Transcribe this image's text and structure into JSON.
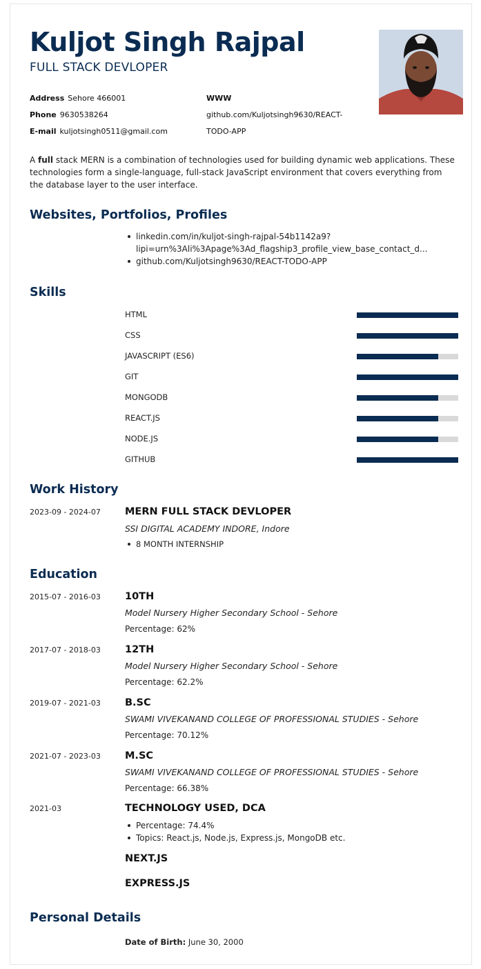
{
  "header": {
    "name": "Kuljot Singh Rajpal",
    "title": "FULL STACK DEVLOPER",
    "photo_alt": "profile-photo"
  },
  "contact": {
    "address_label": "Address",
    "address": "Sehore 466001",
    "phone_label": "Phone",
    "phone": "9630538264",
    "email_label": "E-mail",
    "email": "kuljotsingh0511@gmail.com",
    "www_label": "WWW",
    "www_line1": "github.com/Kuljotsingh9630/REACT-",
    "www_line2": "TODO-APP"
  },
  "summary": {
    "prefix": "A ",
    "bold": "full",
    "rest": " stack MERN is a combination of technologies used for building dynamic web applications. These technologies form a single-language, full-stack JavaScript environment that covers everything from the database layer to the user interface."
  },
  "sections": {
    "websites": "Websites, Portfolios, Profiles",
    "skills": "Skills",
    "work": "Work History",
    "education": "Education",
    "personal": "Personal Details"
  },
  "websites": [
    "linkedin.com/in/kuljot-singh-rajpal-54b1142a9?",
    "lipi=urn%3Ali%3Apage%3Ad_flagship3_profile_view_base_contact_d...",
    "github.com/Kuljotsingh9630/REACT-TODO-APP"
  ],
  "skills": [
    {
      "name": "HTML",
      "level": 1.0
    },
    {
      "name": "CSS",
      "level": 1.0
    },
    {
      "name": "JAVASCRIPT (ES6)",
      "level": 0.8
    },
    {
      "name": "GIT",
      "level": 1.0
    },
    {
      "name": "MONGODB",
      "level": 0.8
    },
    {
      "name": "REACT.JS",
      "level": 0.8
    },
    {
      "name": "NODE.JS",
      "level": 0.8
    },
    {
      "name": "GITHUB",
      "level": 1.0
    }
  ],
  "work": {
    "date": "2023-09 - 2024-07",
    "title": "MERN FULL STACK DEVLOPER",
    "company": "SSI DIGITAL ACADEMY INDORE, Indore",
    "bullet": "8 MONTH INTERNSHIP"
  },
  "education": [
    {
      "date": "2015-07 - 2016-03",
      "title": "10TH",
      "school": "Model Nursery Higher Secondary School - Sehore",
      "detail": "Percentage: 62%"
    },
    {
      "date": "2017-07 - 2018-03",
      "title": "12TH",
      "school": "Model Nursery Higher Secondary School - Sehore",
      "detail": "Percentage: 62.2%"
    },
    {
      "date": "2019-07 - 2021-03",
      "title": "B.SC",
      "school": "SWAMI VIVEKANAND COLLEGE OF PROFESSIONAL STUDIES - Sehore",
      "detail": "Percentage: 70.12%"
    },
    {
      "date": "2021-07 - 2023-03",
      "title": "M.SC",
      "school": "SWAMI VIVEKANAND COLLEGE OF PROFESSIONAL STUDIES - Sehore",
      "detail": "Percentage: 66.38%"
    }
  ],
  "dca": {
    "date": "2021-03",
    "title": "TECHNOLOGY USED, DCA",
    "bullets": [
      "Percentage: 74.4%",
      "Topics: React.js, Node.js, Express.js, MongoDB etc."
    ],
    "extra1": "NEXT.JS",
    "extra2": "EXPRESS.JS"
  },
  "personal": {
    "dob_label": "Date of Birth:",
    "dob": "June 30, 2000"
  }
}
